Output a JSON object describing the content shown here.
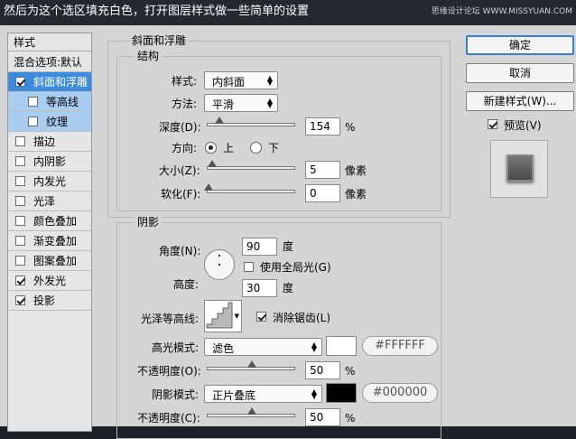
{
  "caption": "然后为这个选区填充白色，打开图层样式做一些简单的设置",
  "site": "思缘设计论坛 WWW.MISSYUAN.COM",
  "left": {
    "header": "样式",
    "blend": "混合选项:默认",
    "items": [
      {
        "label": "斜面和浮雕",
        "checked": true
      },
      {
        "label": "等高线",
        "checked": false
      },
      {
        "label": "纹理",
        "checked": false
      },
      {
        "label": "描边",
        "checked": false
      },
      {
        "label": "内阴影",
        "checked": false
      },
      {
        "label": "内发光",
        "checked": false
      },
      {
        "label": "光泽",
        "checked": false
      },
      {
        "label": "颜色叠加",
        "checked": false
      },
      {
        "label": "渐变叠加",
        "checked": false
      },
      {
        "label": "图案叠加",
        "checked": false
      },
      {
        "label": "外发光",
        "checked": true
      },
      {
        "label": "投影",
        "checked": true
      }
    ]
  },
  "bevel": {
    "title": "斜面和浮雕",
    "structure_title": "结构",
    "style_label": "样式:",
    "style_value": "内斜面",
    "technique_label": "方法:",
    "technique_value": "平滑",
    "depth_label": "深度(D):",
    "depth_value": "154",
    "depth_unit": "%",
    "depth_level": 0.154,
    "direction_label": "方向:",
    "dir_up": "上",
    "dir_down": "下",
    "size_label": "大小(Z):",
    "size_value": "5",
    "size_unit": "像素",
    "soften_label": "软化(F):",
    "soften_value": "0",
    "soften_unit": "像素"
  },
  "shading": {
    "title": "阴影",
    "angle_label": "角度(N):",
    "angle_value": "90",
    "angle_unit": "度",
    "global_light": "使用全局光(G)",
    "altitude_label": "高度:",
    "altitude_value": "30",
    "altitude_unit": "度",
    "gloss_label": "光泽等高线:",
    "antialias": "消除锯齿(L)",
    "highlight_label": "高光模式:",
    "highlight_mode": "滤色",
    "highlight_color": "#FFFFFF",
    "highlight_opacity_label": "不透明度(O):",
    "highlight_opacity": "50",
    "shadow_label": "阴影模式:",
    "shadow_mode": "正片叠底",
    "shadow_color": "#000000",
    "shadow_opacity_label": "不透明度(C):",
    "shadow_opacity": "50",
    "pct": "%"
  },
  "buttons": {
    "ok": "确定",
    "cancel": "取消",
    "new_style": "新建样式(W)...",
    "preview": "预览(V)"
  }
}
